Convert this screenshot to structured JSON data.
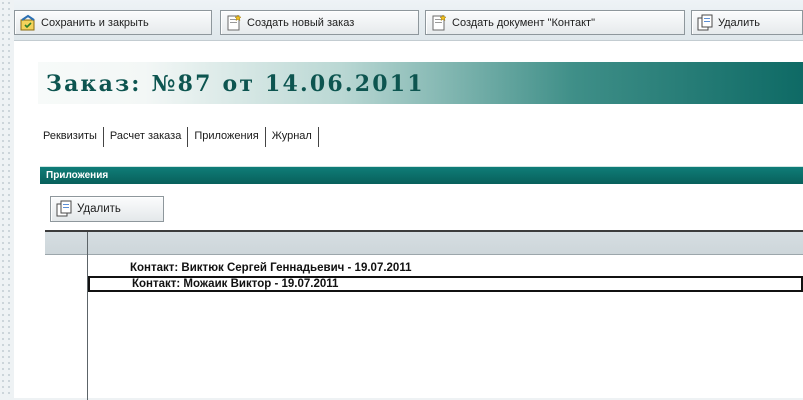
{
  "toolbar": {
    "save_close": "Сохранить и закрыть",
    "new_order": "Создать новый заказ",
    "create_contact": "Создать документ \"Контакт\"",
    "delete": "Удалить"
  },
  "order": {
    "title": "Заказ: №87 от 14.06.2011"
  },
  "tabs": [
    {
      "label": "Реквизиты"
    },
    {
      "label": "Расчет заказа"
    },
    {
      "label": "Приложения"
    },
    {
      "label": "Журнал"
    }
  ],
  "attachments": {
    "header": "Приложения",
    "delete_label": "Удалить",
    "rows": [
      {
        "text": "Контакт: Виктюк Сергей Геннадьевич - 19.07.2011"
      },
      {
        "text": "Контакт: Можаик Виктор - 19.07.2011",
        "selected": true
      }
    ]
  },
  "colors": {
    "accent": "#0b6e69",
    "title_text": "#0d5550"
  },
  "icons": {
    "save_close": "save-close-icon",
    "new_doc": "new-document-icon",
    "delete": "delete-document-icon"
  }
}
